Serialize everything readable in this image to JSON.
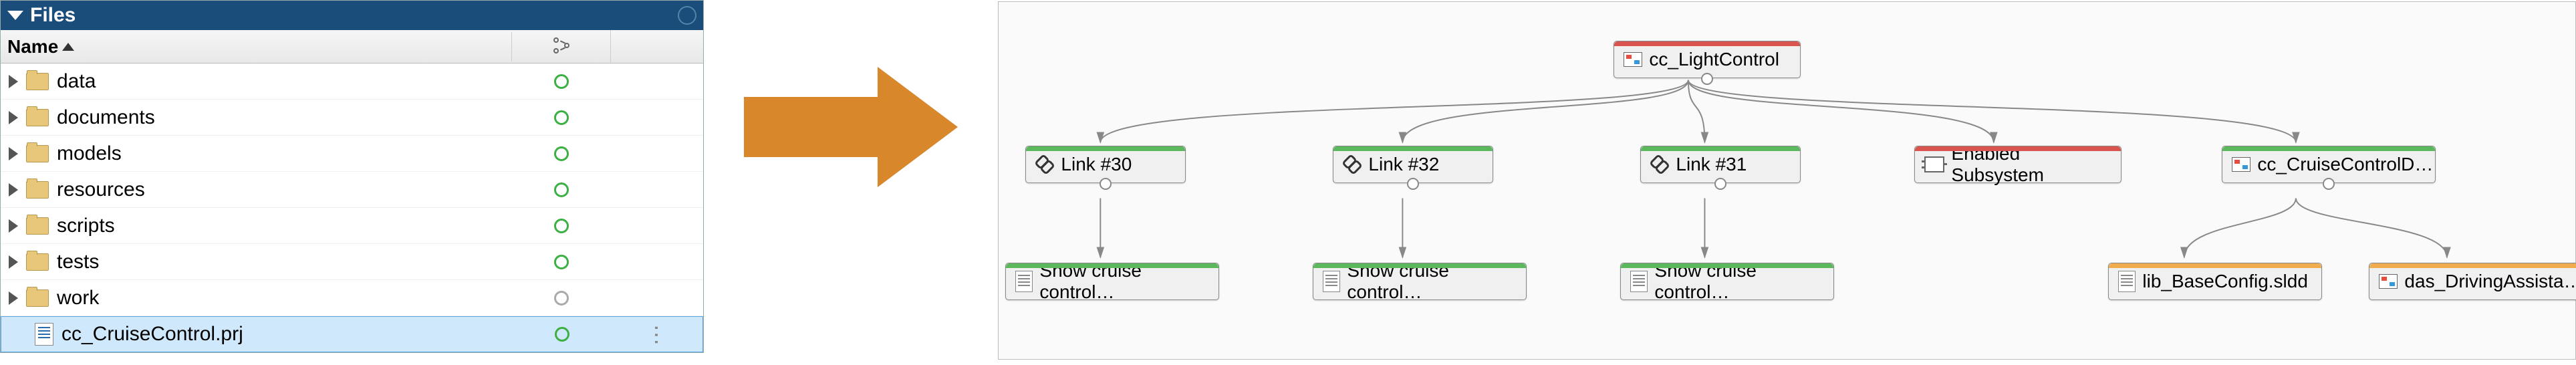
{
  "domain": "Computer-Use",
  "panel": {
    "title": "Files",
    "columns": {
      "name": "Name"
    }
  },
  "tree": [
    {
      "label": "data",
      "type": "folder",
      "status": "green"
    },
    {
      "label": "documents",
      "type": "folder",
      "status": "green"
    },
    {
      "label": "models",
      "type": "folder",
      "status": "green"
    },
    {
      "label": "resources",
      "type": "folder",
      "status": "green"
    },
    {
      "label": "scripts",
      "type": "folder",
      "status": "green"
    },
    {
      "label": "tests",
      "type": "folder",
      "status": "green"
    },
    {
      "label": "work",
      "type": "folder",
      "status": "gray"
    },
    {
      "label": "cc_CruiseControl.prj",
      "type": "file",
      "status": "green",
      "selected": true
    }
  ],
  "diagram": {
    "root": {
      "label": "cc_LightControl",
      "strip": "red"
    },
    "link30": {
      "label": "Link #30",
      "strip": "green"
    },
    "link32": {
      "label": "Link #32",
      "strip": "green"
    },
    "link31": {
      "label": "Link #31",
      "strip": "green"
    },
    "enabled": {
      "label": "Enabled Subsystem",
      "strip": "red"
    },
    "ccd": {
      "label": "cc_CruiseControlD…",
      "strip": "green"
    },
    "show1": {
      "label": "Show cruise control…",
      "strip": "green"
    },
    "show2": {
      "label": "Show cruise control…",
      "strip": "green"
    },
    "show3": {
      "label": "Show cruise control…",
      "strip": "green"
    },
    "lib": {
      "label": "lib_BaseConfig.sldd",
      "strip": "orange"
    },
    "das": {
      "label": "das_DrivingAssista…",
      "strip": "orange"
    }
  }
}
